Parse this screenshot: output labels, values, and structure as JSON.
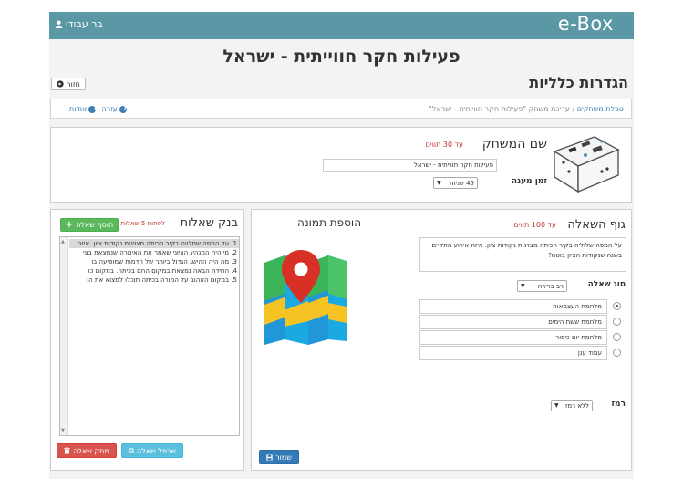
{
  "header": {
    "logo": "e-Box",
    "user_name": "בר עבודי"
  },
  "page": {
    "title": "פעילות חקר חווייתית - ישראל",
    "section_title": "הגדרות כלליות",
    "back_label": "חזור"
  },
  "breadcrumb": {
    "root": "טבלת משחקים",
    "separator": "/",
    "current": "עריכת משחק \"פעילות חקר חווייתית - ישראל\"",
    "help": "עזרה",
    "about": "אודות"
  },
  "game": {
    "name_label": "שם המשחק",
    "name_limit": "עד 30 תווים",
    "name_value": "פעילות חקר חווייתית - ישראל",
    "time_label": "זמן מענה",
    "time_value": "45 שניות"
  },
  "question": {
    "body_title": "גוף השאלה",
    "body_limit": "עד 100 תווים",
    "body_text": "על המפה שלוליה בקיר הכיתה מצוינות נקודות ציון. איזה אירוע התקיים בשנה שנקודות הציון בוטח?",
    "type_label": "סוג שאלה",
    "type_value": "רב ברירה",
    "answers": [
      {
        "text": "מלחמת העצמאות",
        "checked": true
      },
      {
        "text": "מלחמת ששת הימים",
        "checked": false
      },
      {
        "text": "מלחמת יום כיפור",
        "checked": false
      },
      {
        "text": "עמוד ענן",
        "checked": false
      }
    ],
    "hint_label": "רמז",
    "hint_value": "ללא רמז",
    "save_label": "שמור"
  },
  "image": {
    "title": "הוספת תמונה",
    "icon": "map-pin-icon"
  },
  "bank": {
    "title": "בנק שאלות",
    "limit": "לפחות 5 שאלות",
    "add_label": "הוסף שאלה",
    "items": [
      "1. על המפה שתלויה בקיר הכיתה מצוינות נקודות ציון. איזה",
      "2. מי היה המנהיג הציוני שאמר את האימרה שנמצאת בצי",
      "3. מה היה ההישג הגדול ביותר של הדמות שמופיעה בו",
      "4. החידה הבאה נמצאת במקום החם בכיתה. במקום כו",
      "5. במקום האהוב על המורה בכיתה תוכלו למצוא את הו"
    ],
    "duplicate_label": "שכפל שאלה",
    "delete_label": "מחק שאלה"
  },
  "colors": {
    "header": "#5b98a5",
    "limit_text": "#c0392b",
    "link": "#3b7fb6",
    "add_button": "#5cb85c",
    "duplicate_button": "#5bc0de",
    "delete_button": "#d9534f",
    "save_button": "#337ab7"
  }
}
